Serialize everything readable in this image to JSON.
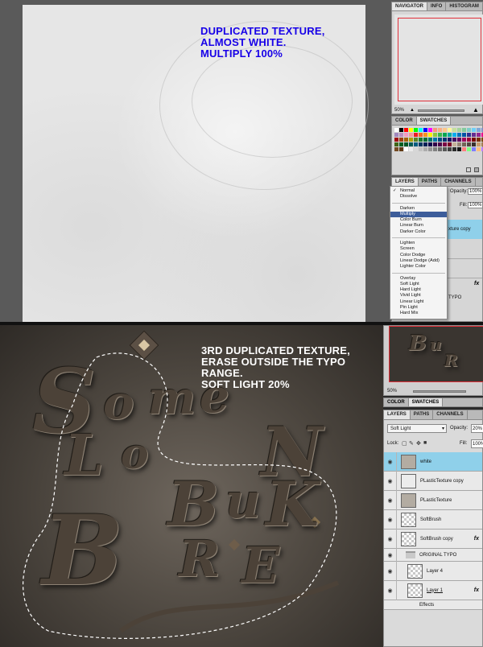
{
  "top": {
    "annotation": [
      "DUPLICATED TEXTURE,",
      "ALMOST WHITE.",
      "MULTIPLY 100%"
    ],
    "navigator": {
      "tabs": [
        "NAVIGATOR",
        "INFO",
        "HISTOGRAM"
      ],
      "zoom": "50%"
    },
    "swatches_panel": {
      "tabs": [
        "COLOR",
        "SWATCHES"
      ],
      "colors": [
        "#ffffff",
        "#000000",
        "#ff0000",
        "#ffff00",
        "#00ff00",
        "#00ffff",
        "#0000ff",
        "#ff00ff",
        "#f7977a",
        "#f9ad81",
        "#fdc68a",
        "#fff79a",
        "#c4df9b",
        "#a2d39c",
        "#82ca9d",
        "#7bcdc8",
        "#6ecff6",
        "#7ea7d8",
        "#8493ca",
        "#8882be",
        "#a187be",
        "#bc8dbf",
        "#f49ac2",
        "#f6989d",
        "#ed1c24",
        "#f26522",
        "#f7941d",
        "#fff200",
        "#8dc73f",
        "#39b54a",
        "#00a651",
        "#00a99d",
        "#00aeef",
        "#0072bc",
        "#0054a6",
        "#2e3192",
        "#662d91",
        "#92278f",
        "#ec008c",
        "#ed145b",
        "#9e0b0f",
        "#a0410d",
        "#a3620a",
        "#aba000",
        "#598527",
        "#1a7b30",
        "#007236",
        "#00746b",
        "#0076a3",
        "#004b80",
        "#003471",
        "#1b1464",
        "#440e62",
        "#630460",
        "#9e005d",
        "#9e0039",
        "#790000",
        "#7b2e00",
        "#7d4900",
        "#827b00",
        "#406618",
        "#005e20",
        "#005826",
        "#005952",
        "#005b7f",
        "#003663",
        "#002157",
        "#0d004c",
        "#32004b",
        "#4b0049",
        "#7b0046",
        "#7a0026",
        "#c7b299",
        "#998675",
        "#736357",
        "#534741",
        "#37302d",
        "#c69c6d",
        "#a67c52",
        "#8c6239",
        "#754c24",
        "#603913",
        "#ffffff",
        "#ebebeb",
        "#d7d7d7",
        "#c2c2c2",
        "#acacac",
        "#959595",
        "#808080",
        "#6c6c6c",
        "#575757",
        "#414141",
        "#2b2b2b",
        "#161616",
        "#ff7f7f",
        "#7fff7f",
        "#7f7fff",
        "#ffbf7f",
        "#bf7fff",
        "#7fffff"
      ]
    },
    "layers_panel": {
      "tabs": [
        "LAYERS",
        "PATHS",
        "CHANNELS"
      ],
      "opacity_label": "Opacity:",
      "opacity_value": "100%",
      "fill_label": "Fill:",
      "fill_value": "100%",
      "row_fragment": "xture copy",
      "row_fragment2": "TYPO",
      "fx": "fx"
    },
    "blend_menu": {
      "groups": [
        [
          "Normal",
          "Dissolve"
        ],
        [
          "Darken",
          "Multiply",
          "Color Burn",
          "Linear Burn",
          "Darker Color"
        ],
        [
          "Lighten",
          "Screen",
          "Color Dodge",
          "Linear Dodge (Add)",
          "Lighter Color"
        ],
        [
          "Overlay",
          "Soft Light",
          "Hard Light",
          "Vivid Light",
          "Linear Light",
          "Pin Light",
          "Hard Mix"
        ]
      ],
      "checked": "Normal",
      "selected": "Multiply",
      "checkmark": "✓"
    }
  },
  "bottom": {
    "annotation": [
      "3RD DUPLICATED TEXTURE,",
      "ERASE OUTSIDE THE TYPO RANGE.",
      "SOFT LIGHT 20%"
    ],
    "letters": [
      "S",
      "o",
      "m",
      "e",
      "L",
      "o",
      "N",
      "B",
      "u",
      "K",
      "B",
      "R",
      "E"
    ],
    "navigator": {
      "zoom": "50%"
    },
    "swatches_tabs": [
      "COLOR",
      "SWATCHES"
    ],
    "layers_panel": {
      "tabs": [
        "LAYERS",
        "PATHS",
        "CHANNELS"
      ],
      "blend_mode": "Soft Light",
      "opacity_label": "Opacity:",
      "opacity_value": "20%",
      "lock_label": "Lock:",
      "fill_label": "Fill:",
      "fill_value": "100%",
      "layers": [
        {
          "name": "white",
          "thumb": "texture",
          "fx": "",
          "selected": true
        },
        {
          "name": "PLasticTexture copy",
          "thumb": "light",
          "fx": "",
          "selected": false
        },
        {
          "name": "PLasticTexture",
          "thumb": "texture",
          "fx": "",
          "selected": false
        },
        {
          "name": "SoftBrush",
          "thumb": "checker",
          "fx": "",
          "selected": false
        },
        {
          "name": "SoftBrush copy",
          "thumb": "checker",
          "fx": "fx",
          "selected": false
        }
      ],
      "group": {
        "name": "ORIGINAL TYPO"
      },
      "sublayers": [
        {
          "name": "Layer 4",
          "fx": ""
        },
        {
          "name": "Layer 1",
          "fx": "fx"
        }
      ],
      "effects_label": "Effects"
    }
  },
  "colors": {
    "annotation_blue": "#1700e8",
    "selected_layer": "#8fd0ea",
    "menu_highlight": "#3d5d9a",
    "navigator_frame": "#e0303a"
  }
}
